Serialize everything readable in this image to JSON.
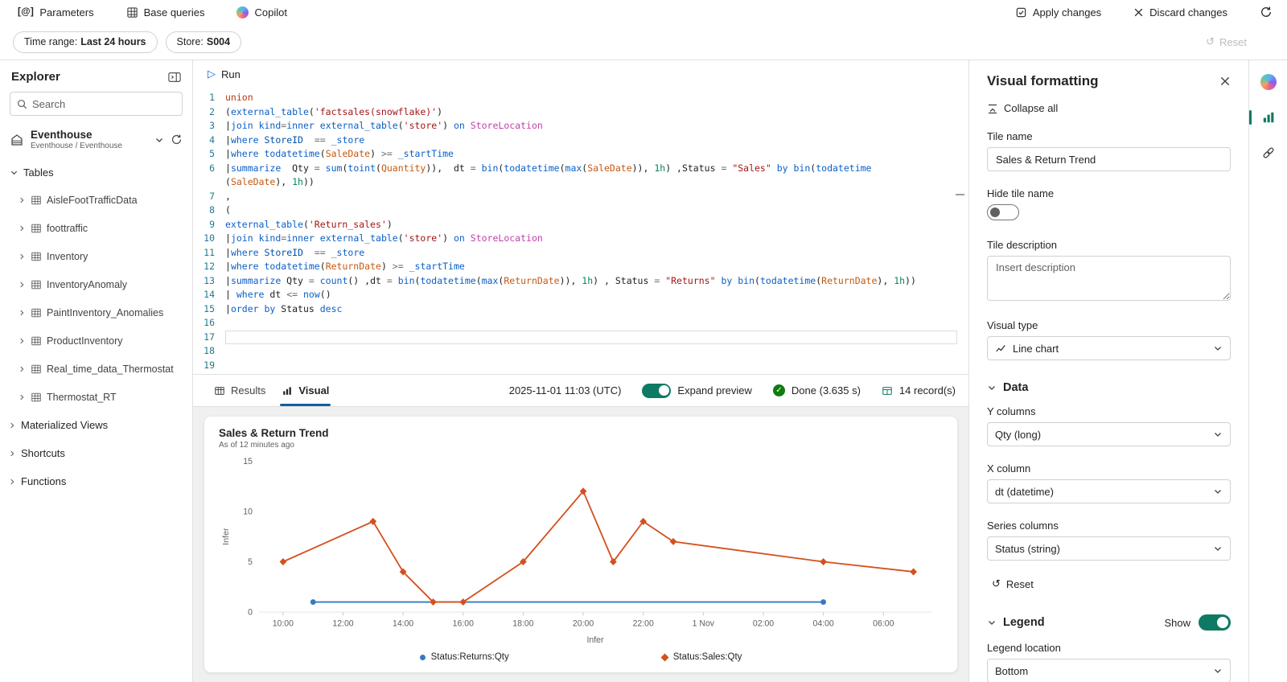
{
  "topbar": {
    "parameters": "Parameters",
    "base_queries": "Base queries",
    "copilot": "Copilot",
    "apply": "Apply changes",
    "discard": "Discard changes"
  },
  "filterbar": {
    "time_range_label": "Time range:",
    "time_range_value": "Last 24 hours",
    "store_label": "Store:",
    "store_value": "S004",
    "reset": "Reset"
  },
  "explorer": {
    "title": "Explorer",
    "search_placeholder": "Search",
    "database": {
      "name": "Eventhouse",
      "path": "Eventhouse / Eventhouse"
    },
    "tables_header": "Tables",
    "tables": [
      "AisleFootTrafficData",
      "foottraffic",
      "Inventory",
      "InventoryAnomaly",
      "PaintInventory_Anomalies",
      "ProductInventory",
      "Real_time_data_Thermostat",
      "Thermostat_RT"
    ],
    "sections": [
      "Materialized Views",
      "Shortcuts",
      "Functions"
    ]
  },
  "editor": {
    "run_label": "Run",
    "lines": [
      {
        "n": 1,
        "tokens": [
          [
            "un",
            "union"
          ]
        ]
      },
      {
        "n": 2,
        "tokens": [
          [
            "d",
            "("
          ],
          [
            "f",
            "external_table"
          ],
          [
            "d",
            "("
          ],
          [
            "s",
            "'factsales(snowflake)'"
          ],
          [
            "d",
            ")"
          ]
        ]
      },
      {
        "n": 3,
        "tokens": [
          [
            "d",
            "|"
          ],
          [
            "k",
            "join"
          ],
          [
            "d",
            " "
          ],
          [
            "k",
            "kind"
          ],
          [
            "o",
            "="
          ],
          [
            "k",
            "inner"
          ],
          [
            "d",
            " "
          ],
          [
            "f",
            "external_table"
          ],
          [
            "d",
            "("
          ],
          [
            "s",
            "'store'"
          ],
          [
            "d",
            ") "
          ],
          [
            "k",
            "on"
          ],
          [
            "d",
            " "
          ],
          [
            "m",
            "StoreLocation"
          ]
        ]
      },
      {
        "n": 4,
        "tokens": [
          [
            "d",
            "|"
          ],
          [
            "k",
            "where"
          ],
          [
            "d",
            " "
          ],
          [
            "i",
            "StoreID"
          ],
          [
            "d",
            "  "
          ],
          [
            "o",
            "=="
          ],
          [
            "d",
            " "
          ],
          [
            "k",
            "_store"
          ]
        ]
      },
      {
        "n": 5,
        "tokens": [
          [
            "d",
            "|"
          ],
          [
            "k",
            "where"
          ],
          [
            "d",
            " "
          ],
          [
            "f",
            "todatetime"
          ],
          [
            "d",
            "("
          ],
          [
            "c",
            "SaleDate"
          ],
          [
            "d",
            ") "
          ],
          [
            "o",
            ">="
          ],
          [
            "d",
            " "
          ],
          [
            "k",
            "_startTime"
          ]
        ]
      },
      {
        "n": 6,
        "tokens": [
          [
            "d",
            "|"
          ],
          [
            "k",
            "summarize"
          ],
          [
            "d",
            "  Qty "
          ],
          [
            "o",
            "="
          ],
          [
            "d",
            " "
          ],
          [
            "f",
            "sum"
          ],
          [
            "d",
            "("
          ],
          [
            "f",
            "toint"
          ],
          [
            "d",
            "("
          ],
          [
            "c",
            "Quantity"
          ],
          [
            "d",
            ")),  dt "
          ],
          [
            "o",
            "="
          ],
          [
            "d",
            " "
          ],
          [
            "f",
            "bin"
          ],
          [
            "d",
            "("
          ],
          [
            "f",
            "todatetime"
          ],
          [
            "d",
            "("
          ],
          [
            "f",
            "max"
          ],
          [
            "d",
            "("
          ],
          [
            "c",
            "SaleDate"
          ],
          [
            "d",
            ")), "
          ],
          [
            "g",
            "1h"
          ],
          [
            "d",
            ") ,Status "
          ],
          [
            "o",
            "="
          ],
          [
            "d",
            " "
          ],
          [
            "s",
            "\"Sales\""
          ],
          [
            "d",
            " "
          ],
          [
            "k",
            "by"
          ],
          [
            "d",
            " "
          ],
          [
            "f",
            "bin"
          ],
          [
            "d",
            "("
          ],
          [
            "f",
            "todatetime"
          ]
        ]
      },
      {
        "n": null,
        "tokens": [
          [
            "d",
            "("
          ],
          [
            "c",
            "SaleDate"
          ],
          [
            "d",
            "), "
          ],
          [
            "g",
            "1h"
          ],
          [
            "d",
            "))"
          ]
        ]
      },
      {
        "n": 7,
        "tokens": [
          [
            "d",
            ","
          ]
        ]
      },
      {
        "n": 8,
        "tokens": [
          [
            "d",
            "("
          ]
        ]
      },
      {
        "n": 9,
        "tokens": [
          [
            "f",
            "external_table"
          ],
          [
            "d",
            "("
          ],
          [
            "s",
            "'Return_sales'"
          ],
          [
            "d",
            ")"
          ]
        ]
      },
      {
        "n": 10,
        "tokens": [
          [
            "d",
            "|"
          ],
          [
            "k",
            "join"
          ],
          [
            "d",
            " "
          ],
          [
            "k",
            "kind"
          ],
          [
            "o",
            "="
          ],
          [
            "k",
            "inner"
          ],
          [
            "d",
            " "
          ],
          [
            "f",
            "external_table"
          ],
          [
            "d",
            "("
          ],
          [
            "s",
            "'store'"
          ],
          [
            "d",
            ") "
          ],
          [
            "k",
            "on"
          ],
          [
            "d",
            " "
          ],
          [
            "m",
            "StoreLocation"
          ]
        ]
      },
      {
        "n": 11,
        "tokens": [
          [
            "d",
            "|"
          ],
          [
            "k",
            "where"
          ],
          [
            "d",
            " "
          ],
          [
            "i",
            "StoreID"
          ],
          [
            "d",
            "  "
          ],
          [
            "o",
            "=="
          ],
          [
            "d",
            " "
          ],
          [
            "k",
            "_store"
          ]
        ]
      },
      {
        "n": 12,
        "tokens": [
          [
            "d",
            "|"
          ],
          [
            "k",
            "where"
          ],
          [
            "d",
            " "
          ],
          [
            "f",
            "todatetime"
          ],
          [
            "d",
            "("
          ],
          [
            "c",
            "ReturnDate"
          ],
          [
            "d",
            ") "
          ],
          [
            "o",
            ">="
          ],
          [
            "d",
            " "
          ],
          [
            "k",
            "_startTime"
          ]
        ]
      },
      {
        "n": 13,
        "tokens": [
          [
            "d",
            "|"
          ],
          [
            "k",
            "summarize"
          ],
          [
            "d",
            " Qty "
          ],
          [
            "o",
            "="
          ],
          [
            "d",
            " "
          ],
          [
            "f",
            "count"
          ],
          [
            "d",
            "() ,dt "
          ],
          [
            "o",
            "="
          ],
          [
            "d",
            " "
          ],
          [
            "f",
            "bin"
          ],
          [
            "d",
            "("
          ],
          [
            "f",
            "todatetime"
          ],
          [
            "d",
            "("
          ],
          [
            "f",
            "max"
          ],
          [
            "d",
            "("
          ],
          [
            "c",
            "ReturnDate"
          ],
          [
            "d",
            ")), "
          ],
          [
            "g",
            "1h"
          ],
          [
            "d",
            ") , Status "
          ],
          [
            "o",
            "="
          ],
          [
            "d",
            " "
          ],
          [
            "s",
            "\"Returns\""
          ],
          [
            "d",
            " "
          ],
          [
            "k",
            "by"
          ],
          [
            "d",
            " "
          ],
          [
            "f",
            "bin"
          ],
          [
            "d",
            "("
          ],
          [
            "f",
            "todatetime"
          ],
          [
            "d",
            "("
          ],
          [
            "c",
            "ReturnDate"
          ],
          [
            "d",
            "), "
          ],
          [
            "g",
            "1h"
          ],
          [
            "d",
            "))"
          ]
        ]
      },
      {
        "n": 14,
        "tokens": [
          [
            "d",
            "| "
          ],
          [
            "k",
            "where"
          ],
          [
            "d",
            " dt "
          ],
          [
            "o",
            "<="
          ],
          [
            "d",
            " "
          ],
          [
            "f",
            "now"
          ],
          [
            "d",
            "()"
          ]
        ]
      },
      {
        "n": 15,
        "tokens": [
          [
            "d",
            "|"
          ],
          [
            "k",
            "order"
          ],
          [
            "d",
            " "
          ],
          [
            "k",
            "by"
          ],
          [
            "d",
            " Status "
          ],
          [
            "k",
            "desc"
          ]
        ]
      },
      {
        "n": 16,
        "tokens": []
      },
      {
        "n": 17,
        "tokens": [],
        "active": true
      },
      {
        "n": 18,
        "tokens": []
      },
      {
        "n": 19,
        "tokens": []
      }
    ]
  },
  "statusbar": {
    "results_tab": "Results",
    "visual_tab": "Visual",
    "timestamp": "2025-11-01 11:03 (UTC)",
    "expand_preview": "Expand preview",
    "done": "Done (3.635 s)",
    "records": "14 record(s)"
  },
  "chart_data": {
    "type": "line",
    "title": "Sales & Return Trend",
    "subtitle": "As of 12 minutes ago",
    "xlabel": "Infer",
    "ylabel": "Infer",
    "x_encoding": "hours relative to first tick (10:00)",
    "xlim": [
      -0.8,
      21.6
    ],
    "ylim": [
      0,
      15
    ],
    "yticks": [
      0,
      5,
      10,
      15
    ],
    "xticks": [
      {
        "x": 0,
        "label": "10:00"
      },
      {
        "x": 2,
        "label": "12:00"
      },
      {
        "x": 4,
        "label": "14:00"
      },
      {
        "x": 6,
        "label": "16:00"
      },
      {
        "x": 8,
        "label": "18:00"
      },
      {
        "x": 10,
        "label": "20:00"
      },
      {
        "x": 12,
        "label": "22:00"
      },
      {
        "x": 14,
        "label": "1 Nov"
      },
      {
        "x": 16,
        "label": "02:00"
      },
      {
        "x": 18,
        "label": "04:00"
      },
      {
        "x": 20,
        "label": "06:00"
      }
    ],
    "legend_position": "bottom",
    "grid": false,
    "series": [
      {
        "name": "Status:Returns:Qty",
        "color": "#3779c2",
        "marker": "circle",
        "points": [
          [
            1,
            1
          ],
          [
            18,
            1
          ]
        ]
      },
      {
        "name": "Status:Sales:Qty",
        "color": "#d4501e",
        "marker": "diamond",
        "points": [
          [
            0,
            5
          ],
          [
            3,
            9
          ],
          [
            4,
            4
          ],
          [
            5,
            1
          ],
          [
            6,
            1
          ],
          [
            8,
            5
          ],
          [
            10,
            12
          ],
          [
            11,
            5
          ],
          [
            12,
            9
          ],
          [
            13,
            7
          ],
          [
            18,
            5
          ],
          [
            21,
            4
          ]
        ]
      }
    ]
  },
  "formatting": {
    "title": "Visual formatting",
    "collapse_all": "Collapse all",
    "tile_name_label": "Tile name",
    "tile_name_value": "Sales & Return Trend",
    "hide_tile_name_label": "Hide tile name",
    "tile_description_label": "Tile description",
    "tile_description_placeholder": "Insert description",
    "visual_type_label": "Visual type",
    "visual_type_value": "Line chart",
    "data_section_label": "Data",
    "y_columns_label": "Y columns",
    "y_columns_value": "Qty (long)",
    "x_column_label": "X column",
    "x_column_value": "dt (datetime)",
    "series_columns_label": "Series columns",
    "series_columns_value": "Status (string)",
    "reset_label": "Reset",
    "legend_section_label": "Legend",
    "legend_show_label": "Show",
    "legend_location_label": "Legend location",
    "legend_location_value": "Bottom"
  },
  "icons": {
    "play": "▷",
    "undo": "↺",
    "check": "✓",
    "parameters_glyph": "[@]"
  }
}
